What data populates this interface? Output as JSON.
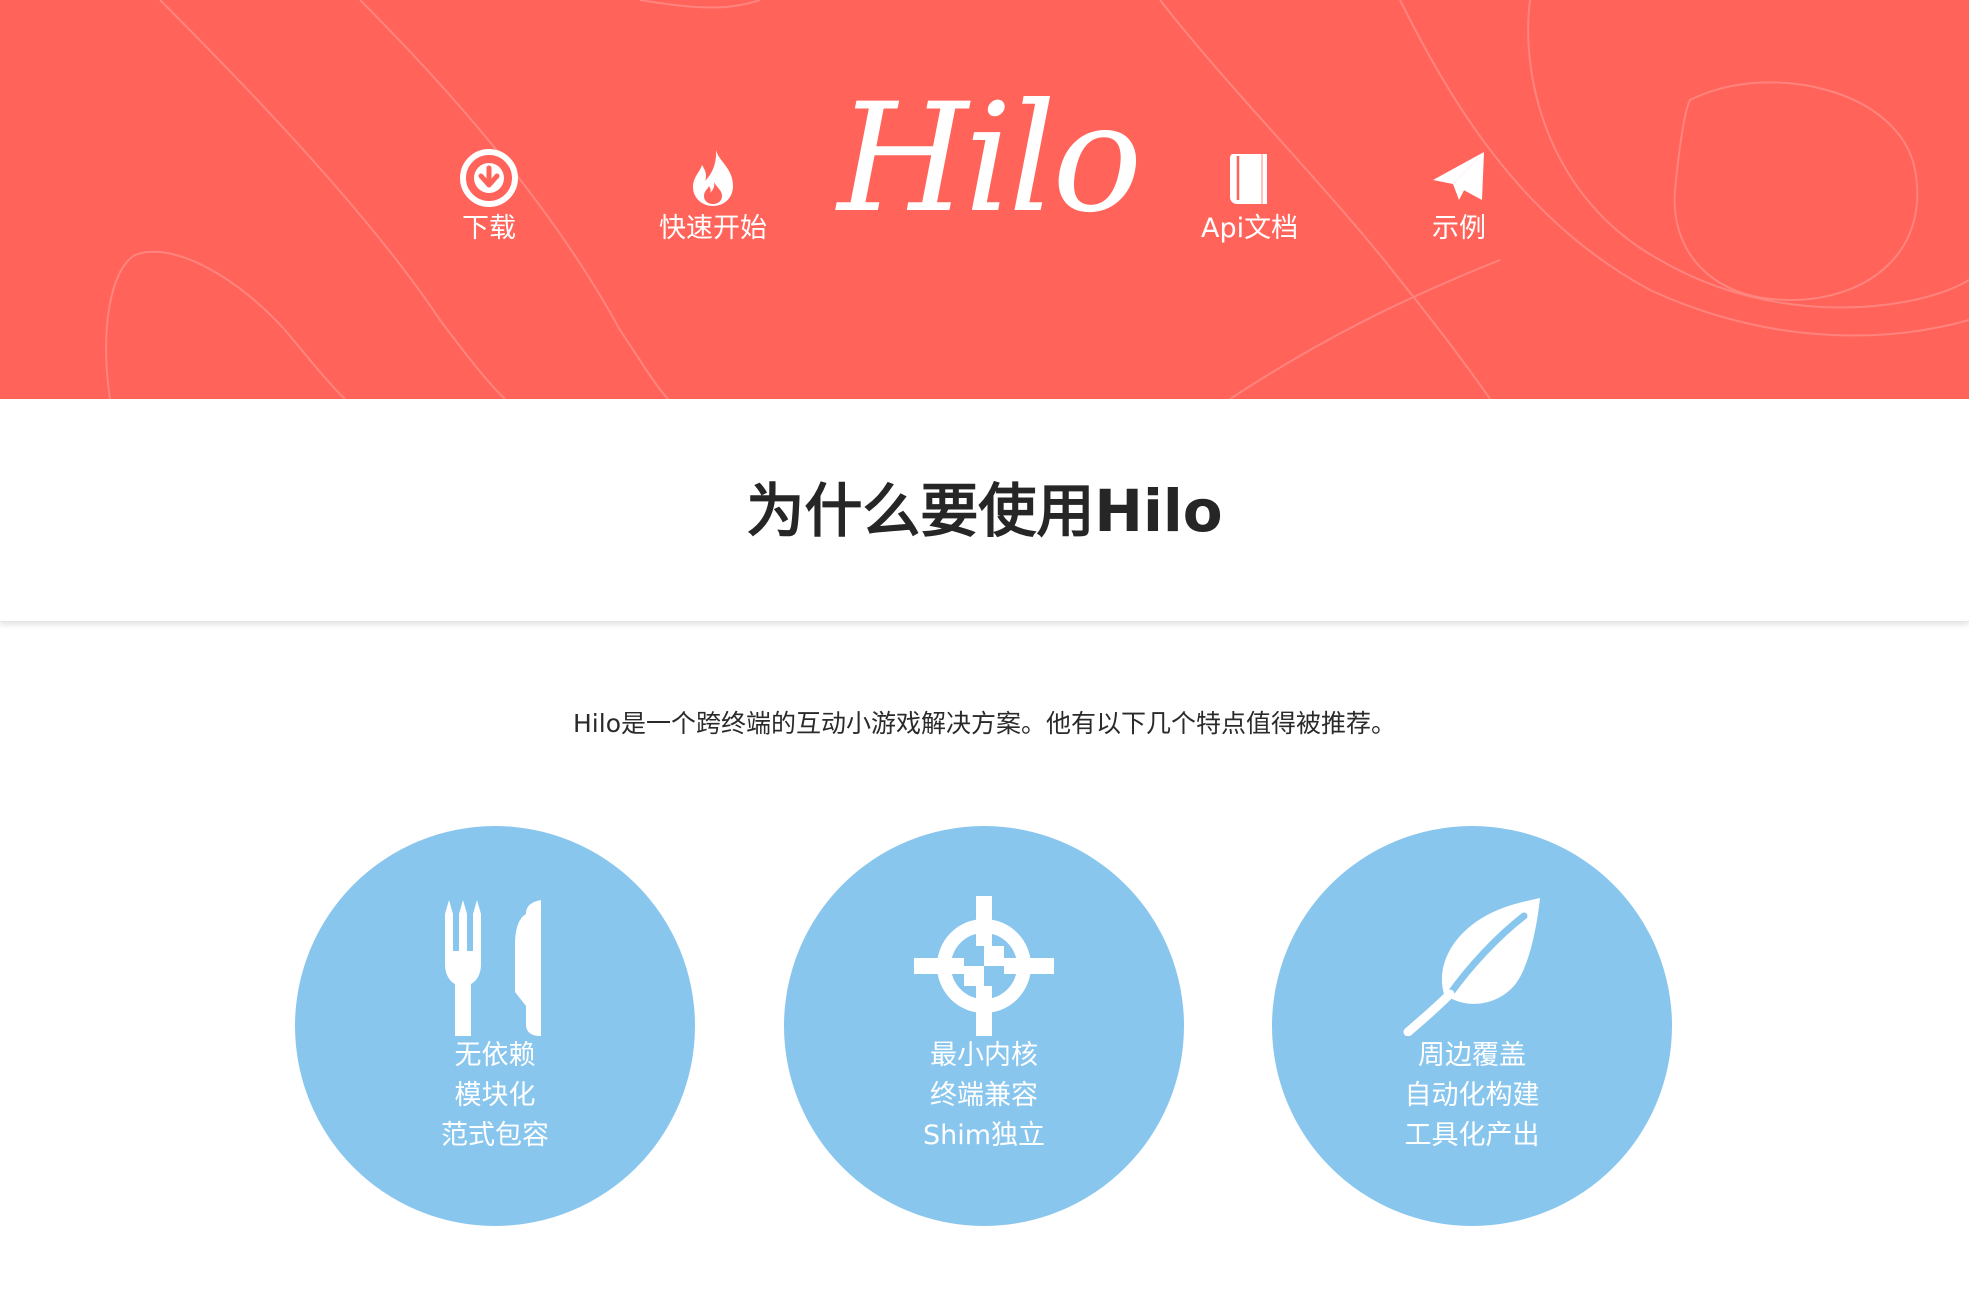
{
  "header": {
    "logo": "Hilo",
    "nav": {
      "download": {
        "label": "下载",
        "icon": "download-circle-icon"
      },
      "quickstart": {
        "label": "快速开始",
        "icon": "fire-icon"
      },
      "api": {
        "label": "Api文档",
        "icon": "book-icon"
      },
      "examples": {
        "label": "示例",
        "icon": "paper-plane-icon"
      }
    }
  },
  "section": {
    "title_prefix": "为什么要使用",
    "title_brand": "Hilo"
  },
  "intro": "Hilo是一个跨终端的互动小游戏解决方案。他有以下几个特点值得被推荐。",
  "features": {
    "a": {
      "icon": "fork-knife-icon",
      "lines": [
        "无依赖",
        "模块化",
        "范式包容"
      ]
    },
    "b": {
      "icon": "crosshair-icon",
      "lines": [
        "最小内核",
        "终端兼容",
        "Shim独立"
      ]
    },
    "c": {
      "icon": "leaf-icon",
      "lines": [
        "周边覆盖",
        "自动化构建",
        "工具化产出"
      ]
    }
  },
  "colors": {
    "header_bg": "#ff635a",
    "circle_bg": "#89c6ee",
    "text_dark": "#262626",
    "white": "#ffffff"
  }
}
